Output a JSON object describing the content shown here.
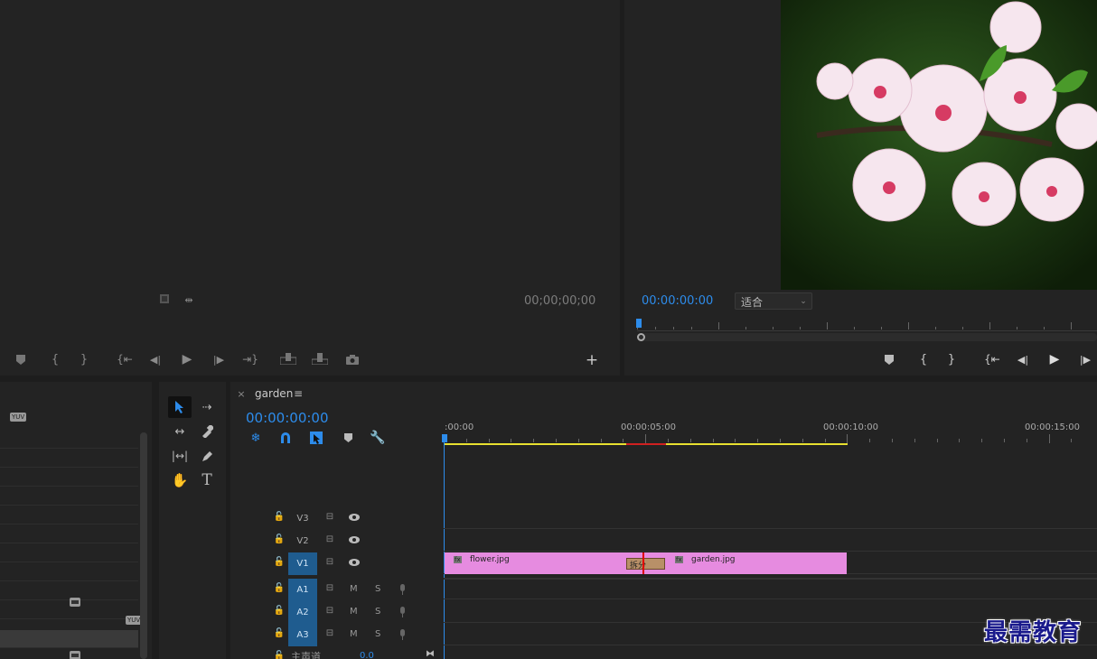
{
  "source_monitor": {
    "timecode": "00;00;00;00"
  },
  "program_monitor": {
    "timecode": "00:00:00:00",
    "fit_option": "适合"
  },
  "project_panel": {
    "badges": [
      "YUV",
      "YUV",
      "YUV"
    ]
  },
  "timeline": {
    "sequence_name": "garden",
    "timecode": "00:00:00:00",
    "ruler": [
      ":00:00",
      "00:00:05:00",
      "00:00:10:00",
      "00:00:15:00"
    ],
    "tracks_video": [
      "V3",
      "V2",
      "V1"
    ],
    "tracks_audio": [
      "A1",
      "A2",
      "A3"
    ],
    "mute_label": "M",
    "solo_label": "S",
    "master_label": "主声道",
    "master_value": "0.0",
    "clips": [
      {
        "name": "flower.jpg",
        "badge": "fx"
      },
      {
        "name": "garden.jpg",
        "badge": "fx"
      }
    ],
    "transition_label": "拆分"
  },
  "watermark": "最需教育",
  "colors": {
    "accent_blue": "#2d8ceb",
    "clip_pink": "#e68be0",
    "track_selected": "#1f5c8f",
    "work_area_yellow": "#e8e030",
    "render_red": "#d02020"
  }
}
